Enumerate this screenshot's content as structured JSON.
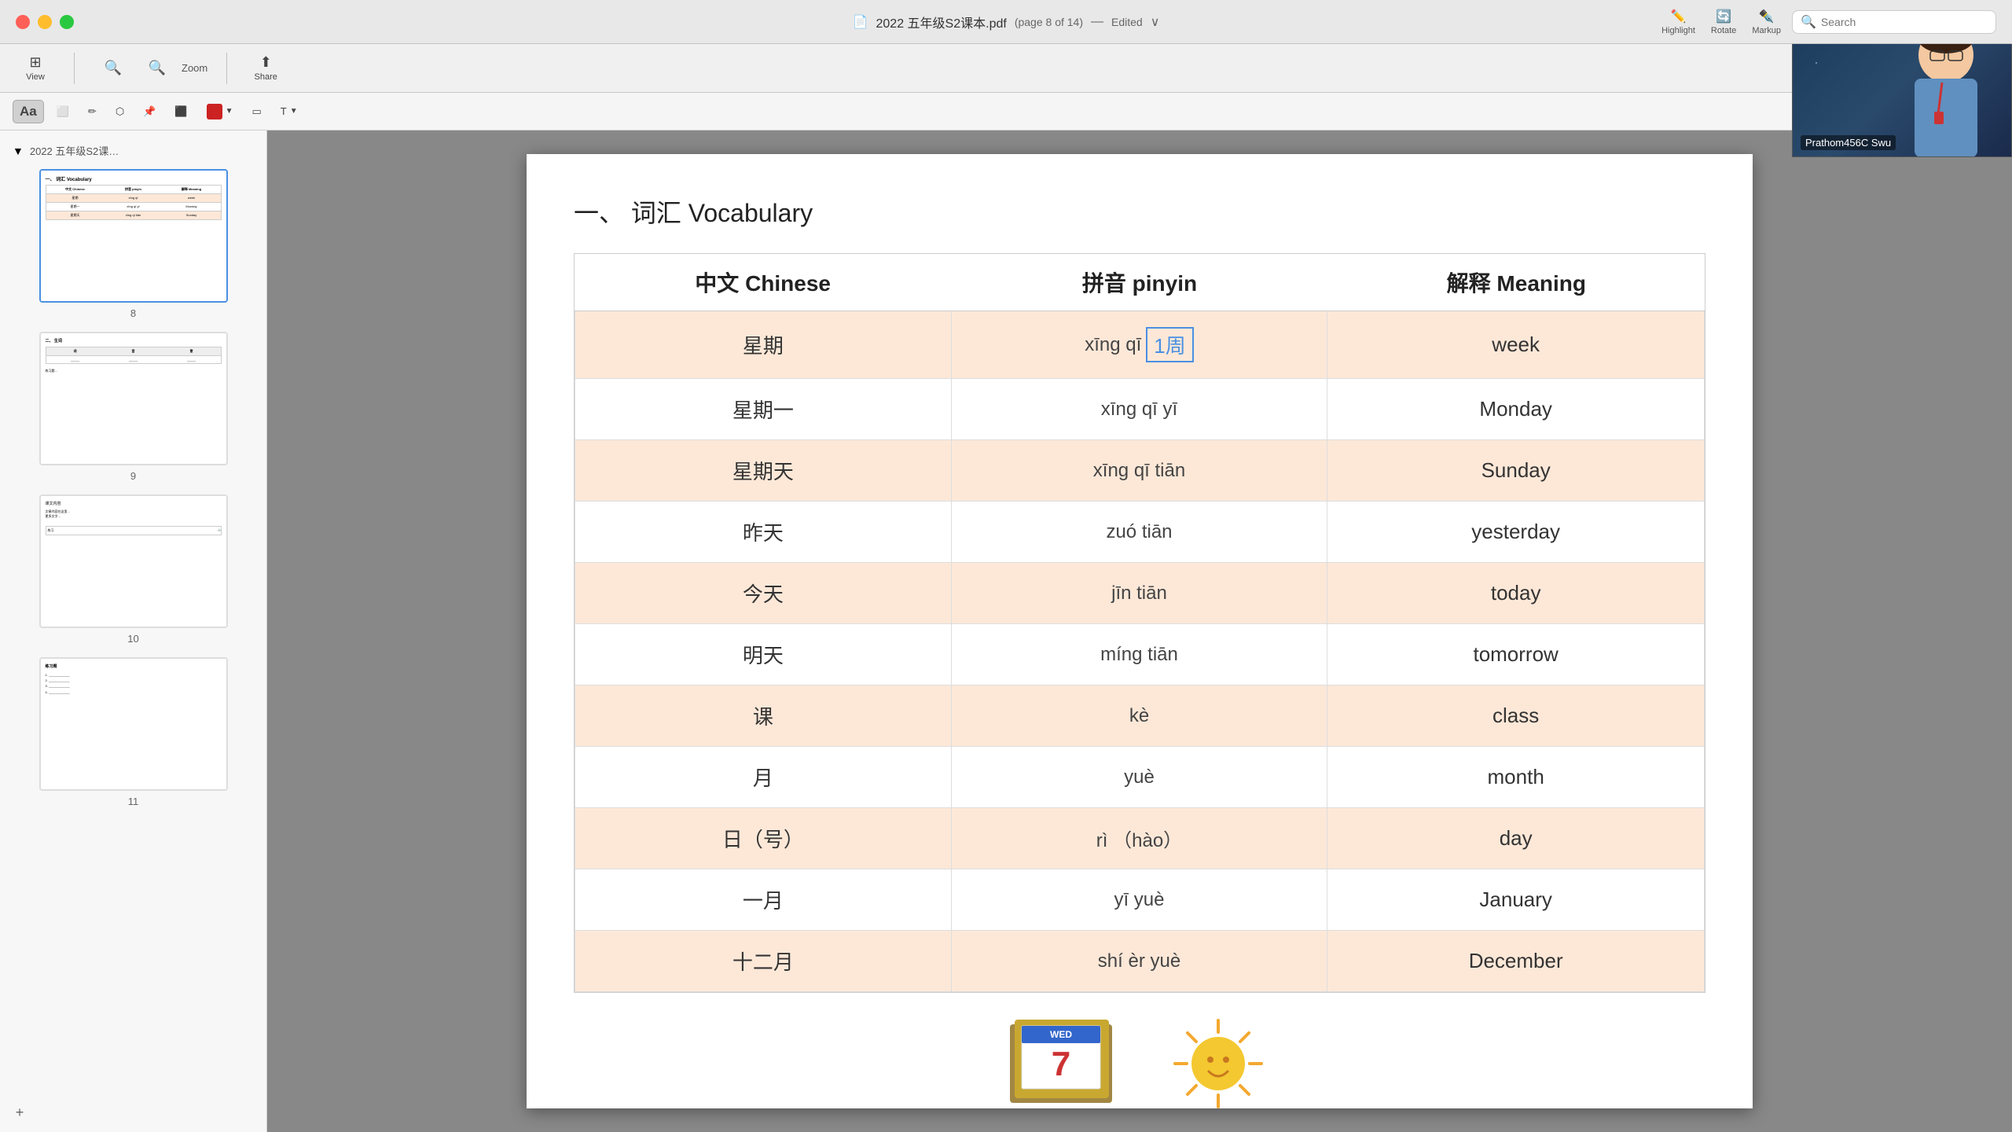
{
  "titlebar": {
    "title": "2022 五年级S2课本.pdf (page 8 of 14) — Edited",
    "title_short": "2022 五年级S2课本.pdf",
    "page_info": "(page 8 of 14)",
    "edited_label": "Edited",
    "chevron": "›"
  },
  "toolbar1": {
    "view_label": "View",
    "zoom_label": "Zoom",
    "share_label": "Share",
    "highlight_label": "Highlight",
    "rotate_label": "Rotate",
    "markup_label": "Markup",
    "search_label": "Search",
    "search_placeholder": "Search"
  },
  "toolbar2": {
    "aa_label": "Aa",
    "tools": [
      "✏️",
      "⬡",
      "⬡",
      "📌",
      "🔳",
      "T"
    ]
  },
  "sidebar": {
    "title": "2022 五年级S2课…",
    "pages": [
      {
        "num": "8",
        "active": true
      },
      {
        "num": "9",
        "active": false
      },
      {
        "num": "10",
        "active": false
      },
      {
        "num": "11",
        "active": false
      }
    ],
    "add_label": "+"
  },
  "pdf": {
    "section_title": "一、 词汇  Vocabulary",
    "header": {
      "col1": "中文  Chinese",
      "col2": "拼音  pinyin",
      "col3": "解释  Meaning"
    },
    "rows": [
      {
        "chinese": "星期",
        "pinyin": "xīng qī",
        "meaning": "week",
        "shaded": true,
        "annotation": "1周"
      },
      {
        "chinese": "星期一",
        "pinyin": "xīng qī yī",
        "meaning": "Monday",
        "shaded": false
      },
      {
        "chinese": "星期天",
        "pinyin": "xīng qī tiān",
        "meaning": "Sunday",
        "shaded": true
      },
      {
        "chinese": "昨天",
        "pinyin": "zuó tiān",
        "meaning": "yesterday",
        "shaded": false
      },
      {
        "chinese": "今天",
        "pinyin": "jīn tiān",
        "meaning": "today",
        "shaded": true
      },
      {
        "chinese": "明天",
        "pinyin": "míng tiān",
        "meaning": "tomorrow",
        "shaded": false
      },
      {
        "chinese": "课",
        "pinyin": "kè",
        "meaning": "class",
        "shaded": true
      },
      {
        "chinese": "月",
        "pinyin": "yuè",
        "meaning": "month",
        "shaded": false
      },
      {
        "chinese": "日（号）",
        "pinyin": "rì  （hào）",
        "meaning": "day",
        "shaded": true
      },
      {
        "chinese": "一月",
        "pinyin": "yī yuè",
        "meaning": "January",
        "shaded": false
      },
      {
        "chinese": "十二月",
        "pinyin": "shí èr yuè",
        "meaning": "December",
        "shaded": true
      }
    ]
  },
  "webcam": {
    "label": "Prathom456C Swu"
  }
}
